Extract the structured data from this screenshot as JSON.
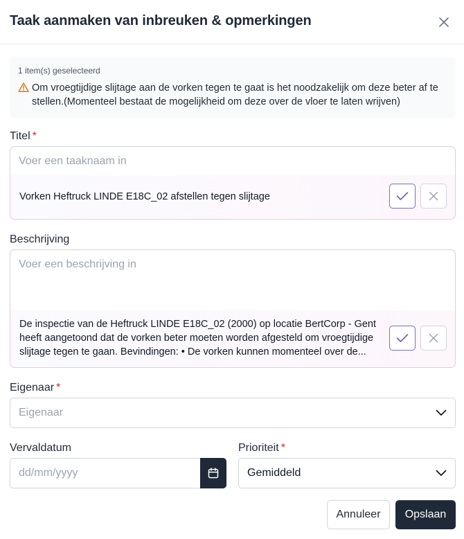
{
  "dialog": {
    "title": "Taak aanmaken van inbreuken & opmerkingen"
  },
  "notice": {
    "count": "1 item(s) geselecteerd",
    "text": "Om vroegtijdige slijtage aan de vorken tegen te gaat is het noodzakelijk om deze beter af te stellen.(Momenteel bestaat de mogelijkheid om deze over de vloer te laten wrijven)"
  },
  "form": {
    "title": {
      "label": "Titel",
      "required": "*",
      "placeholder": "Voer een taaknaam in",
      "suggestion": "Vorken Heftruck LINDE E18C_02 afstellen tegen slijtage"
    },
    "description": {
      "label": "Beschrijving",
      "placeholder": "Voer een beschrijving in",
      "suggestion": "De inspectie van de Heftruck LINDE E18C_02 (2000) op locatie BertCorp - Gent heeft aangetoond dat de vorken beter moeten worden afgesteld om vroegtijdige slijtage tegen te gaan. Bevindingen: • De vorken kunnen momenteel over de..."
    },
    "owner": {
      "label": "Eigenaar",
      "required": "*",
      "placeholder": "Eigenaar"
    },
    "due_date": {
      "label": "Vervaldatum",
      "placeholder": "dd/mm/yyyy"
    },
    "priority": {
      "label": "Prioriteit",
      "required": "*",
      "selected": "Gemiddeld"
    }
  },
  "actions": {
    "cancel_label": "Annuleer",
    "save_label": "Opslaan"
  },
  "colors": {
    "primary": "#1f2937",
    "accent": "#7c6cc9",
    "required": "#dc2626",
    "warning": "#d97706"
  },
  "icons": {
    "close": "close-icon",
    "warning": "warning-icon",
    "accept": "check-icon",
    "reject": "x-icon",
    "dropdown": "chevron-down-icon",
    "calendar": "calendar-icon"
  }
}
